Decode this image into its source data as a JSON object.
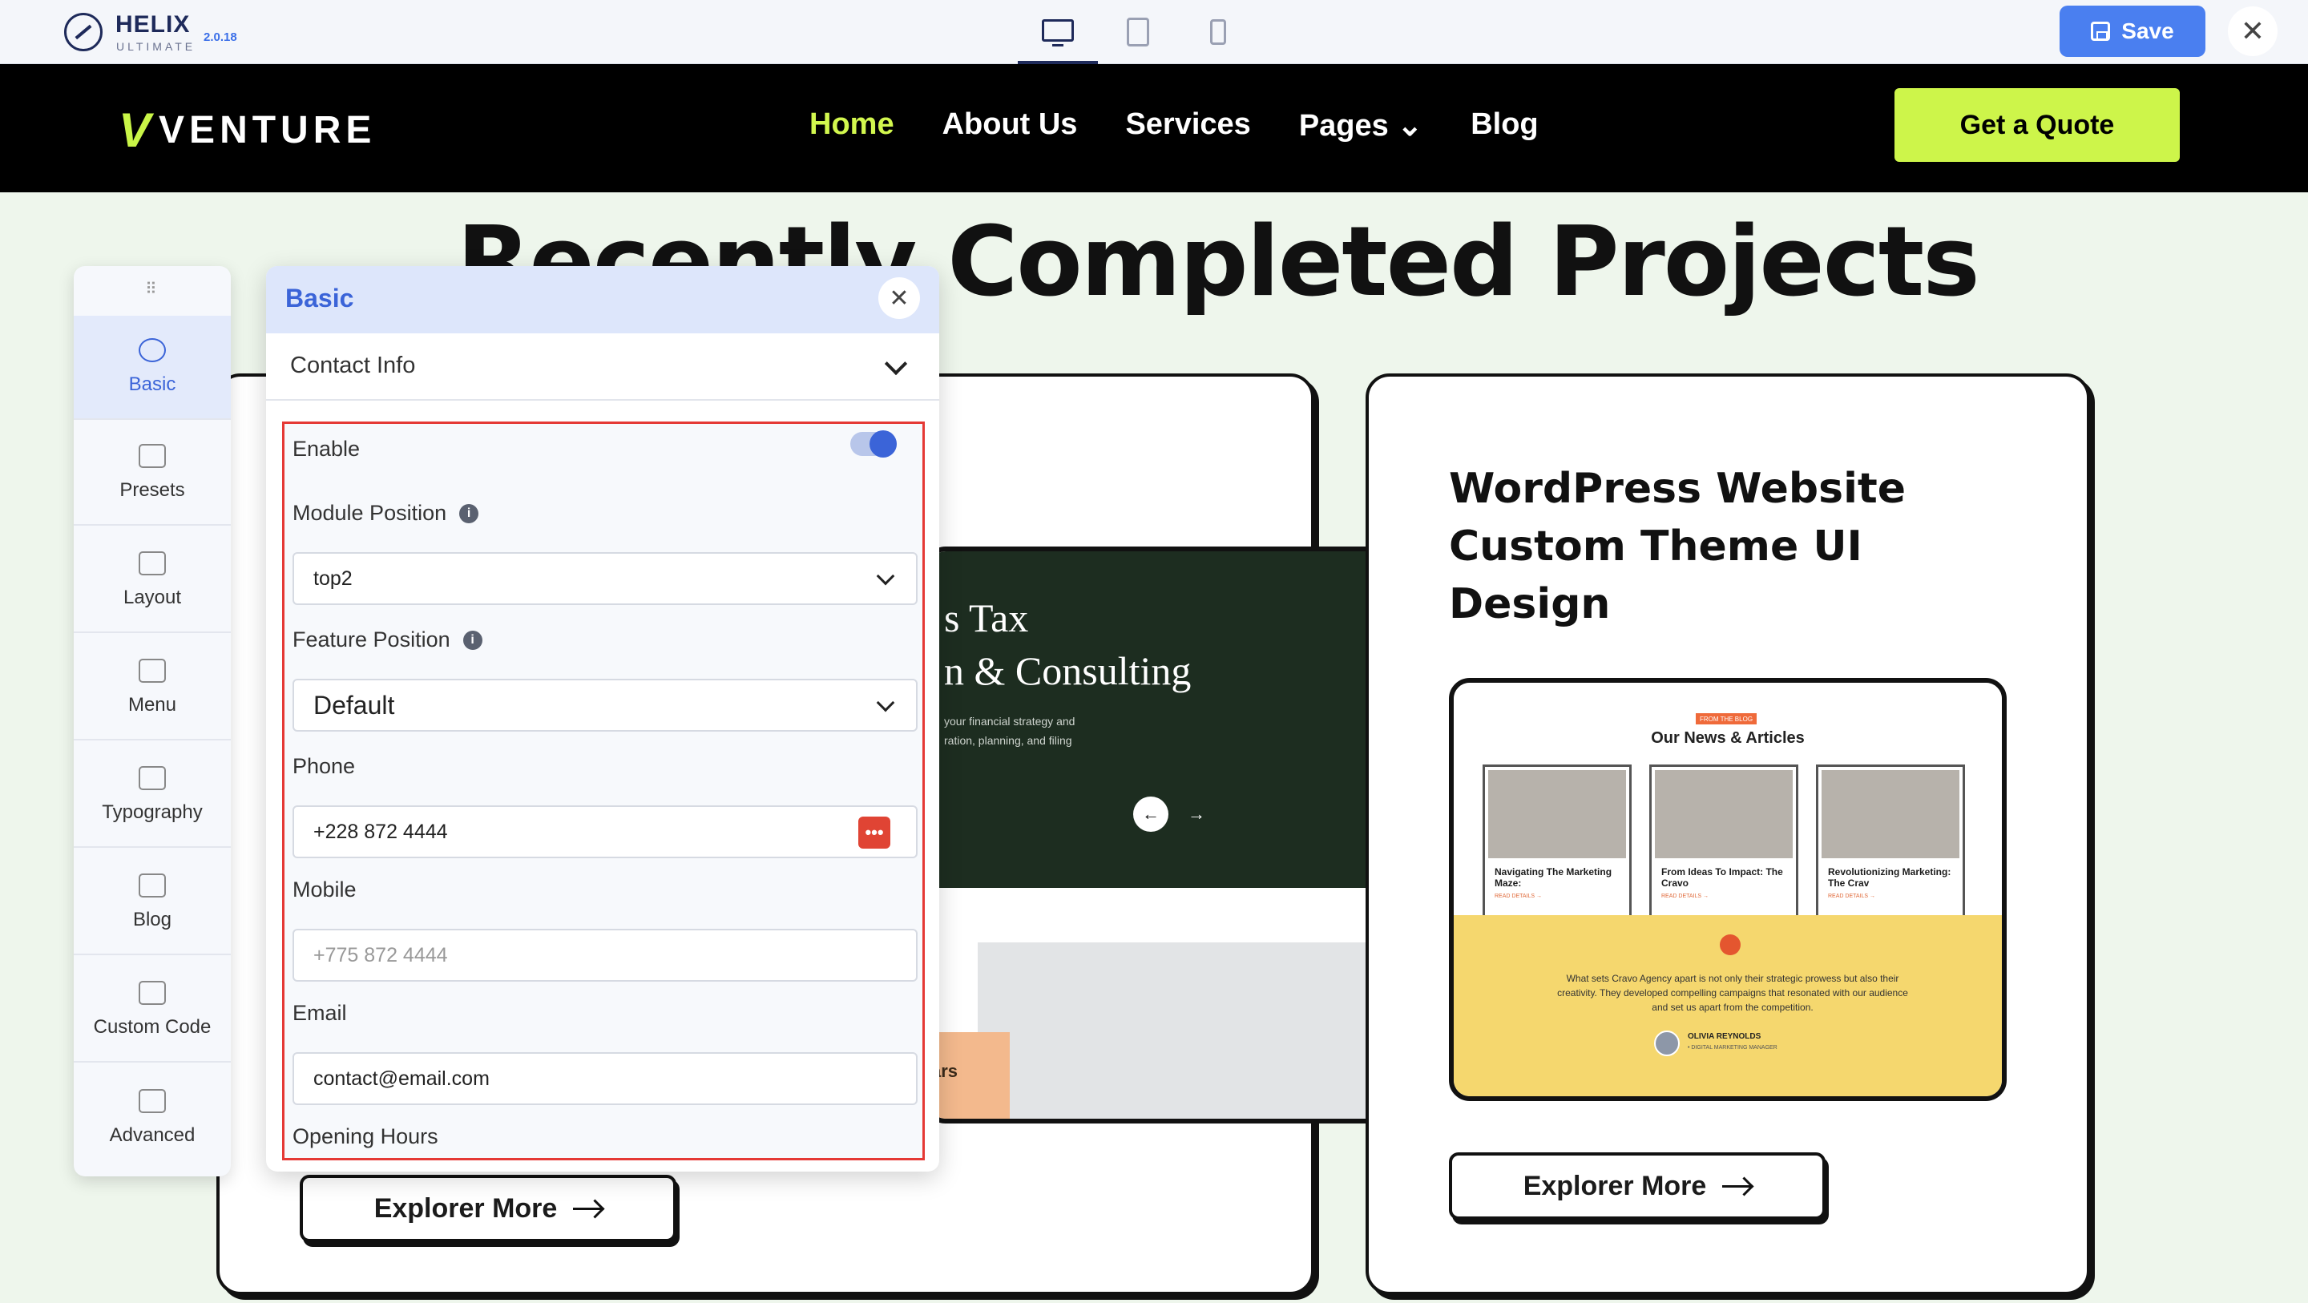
{
  "topbar": {
    "logo_name": "HELIX",
    "logo_sub": "ULTIMATE",
    "version": "2.0.18",
    "devices": [
      "desktop-icon",
      "tablet-icon",
      "mobile-icon"
    ],
    "save_label": "Save",
    "close_symbol": "✕"
  },
  "site": {
    "brand": "VENTURE",
    "brand_mark": "V",
    "nav": [
      "Home",
      "About Us",
      "Services",
      "Pages",
      "Blog"
    ],
    "nav_active": "Home",
    "pages_caret": "⌄",
    "quote_label": "Get a Quote",
    "accent_color": "#cdf54a"
  },
  "main": {
    "section_title": "Recently Completed Projects",
    "card1": {
      "preview_heading": "s Tax\nn & Consulting",
      "preview_text": "your financial strategy and\nration, planning, and filing",
      "preview_corner": "ars",
      "arrow_left": "←",
      "arrow_right": "→",
      "explore_label": "Explorer More"
    },
    "card2": {
      "title": "WordPress Website Custom Theme UI Design",
      "badge": "FROM THE BLOG",
      "preview_heading": "Our News & Articles",
      "posts": [
        {
          "title": "Navigating The Marketing Maze:",
          "link": "READ DETAILS →"
        },
        {
          "title": "From Ideas To Impact: The Cravo",
          "link": "READ DETAILS →"
        },
        {
          "title": "Revolutionizing Marketing: The Crav",
          "link": "READ DETAILS →"
        }
      ],
      "testimonial": "What sets Cravo Agency apart is not only their strategic prowess but also their creativity. They developed compelling campaigns that resonated with our audience and set us apart from the competition.",
      "author": "OLIVIA REYNOLDS",
      "author_role": "• DIGITAL MARKETING MANAGER",
      "explore_label": "Explorer More"
    }
  },
  "toolbar": {
    "grip": "⠿",
    "items": [
      {
        "label": "Basic",
        "icon": "gear-icon",
        "active": true
      },
      {
        "label": "Presets",
        "icon": "sliders-icon"
      },
      {
        "label": "Layout",
        "icon": "layout-icon"
      },
      {
        "label": "Menu",
        "icon": "menu-icon"
      },
      {
        "label": "Typography",
        "icon": "typography-icon"
      },
      {
        "label": "Blog",
        "icon": "blog-icon"
      },
      {
        "label": "Custom Code",
        "icon": "code-icon"
      },
      {
        "label": "Advanced",
        "icon": "advanced-icon"
      }
    ]
  },
  "panel": {
    "title": "Basic",
    "section": "Contact Info",
    "enable_label": "Enable",
    "enable_on": true,
    "module_position_label": "Module Position",
    "module_position_value": "top2",
    "feature_position_label": "Feature Position",
    "feature_position_value": "Default",
    "phone_label": "Phone",
    "phone_value": "+228 872 4444",
    "mobile_label": "Mobile",
    "mobile_placeholder": "+775 872 4444",
    "email_label": "Email",
    "email_value": "contact@email.com",
    "opening_hours_label": "Opening Hours",
    "info_symbol": "i",
    "dots_symbol": "•••"
  }
}
